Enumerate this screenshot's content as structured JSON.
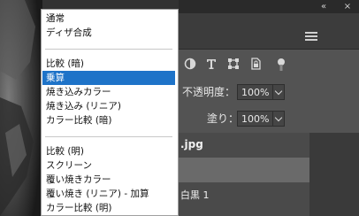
{
  "window": {
    "collapse_icon": "«",
    "close_icon": "×"
  },
  "panel_menu_icon": "hamburger-menu-icon",
  "toolbar_icons": [
    "circle-half-icon",
    "type-icon",
    "transform-icon",
    "lock-artboard-icon",
    "pin-icon"
  ],
  "layer_props": {
    "opacity_label": "不透明度：",
    "opacity_value": "100%",
    "fill_label": "塗り：",
    "fill_value": "100%"
  },
  "layers": {
    "file_name": ".jpg",
    "row3_label": "白黒 1"
  },
  "blend_dropdown": {
    "items": [
      "通常",
      "ディザ合成",
      "比較 (暗)",
      "乗算",
      "焼き込みカラー",
      "焼き込み (リニア)",
      "カラー比較 (暗)",
      "比較 (明)",
      "スクリーン",
      "覆い焼きカラー",
      "覆い焼き (リニア) - 加算",
      "カラー比較 (明)"
    ],
    "selected": "乗算"
  },
  "colors": {
    "selection": "#1e73c8",
    "panel": "#535353",
    "dark": "#2a2a2a"
  }
}
